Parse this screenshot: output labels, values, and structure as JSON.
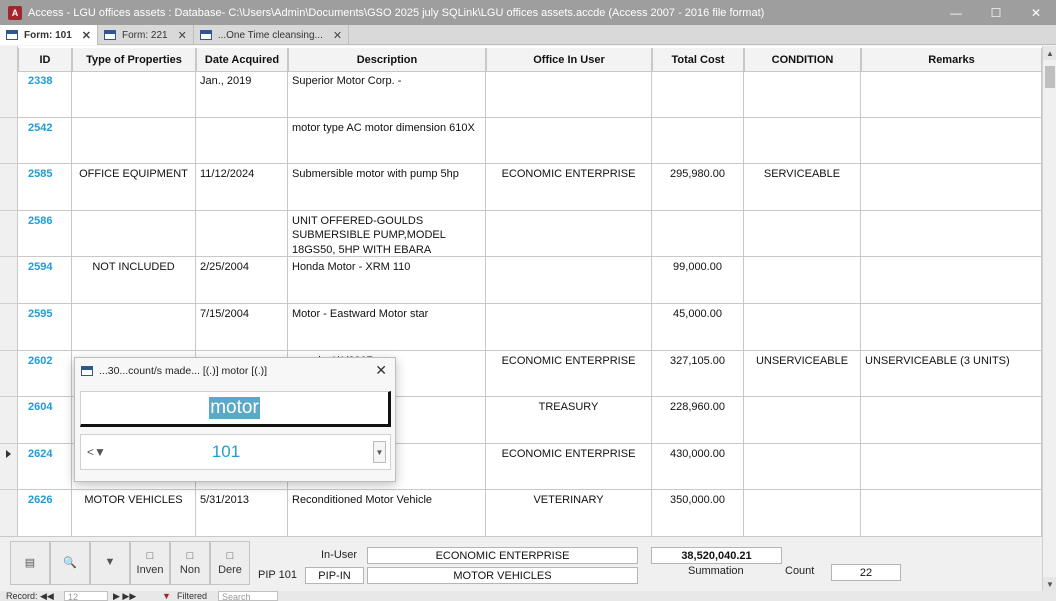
{
  "window": {
    "title": "Access - LGU offices assets : Database- C:\\Users\\Admin\\Documents\\GSO 2025 july SQLink\\LGU offices assets.accde (Access 2007 - 2016 file format)",
    "app_badge": "A"
  },
  "tabs": [
    {
      "label": "Form: 101",
      "active": true
    },
    {
      "label": "Form: 221",
      "active": false
    },
    {
      "label": "...One Time cleansing...",
      "active": false
    }
  ],
  "columns": [
    "ID",
    "Type of Properties",
    "Date Acquired",
    "Description",
    "Office In User",
    "Total Cost",
    "CONDITION",
    "Remarks"
  ],
  "rows": [
    {
      "id": "2338",
      "type": "",
      "date": "Jan., 2019",
      "desc": "Superior Motor Corp. -",
      "office": "",
      "cost": "",
      "condition": "",
      "remarks": ""
    },
    {
      "id": "2542",
      "type": "",
      "date": "",
      "desc": "motor type AC motor dimension 610X",
      "office": "",
      "cost": "",
      "condition": "",
      "remarks": ""
    },
    {
      "id": "2585",
      "type": "OFFICE EQUIPMENT",
      "date": "11/12/2024",
      "desc": "Submersible motor with pump 5hp",
      "office": "ECONOMIC ENTERPRISE",
      "cost": "295,980.00",
      "condition": "SERVICEABLE",
      "remarks": ""
    },
    {
      "id": "2586",
      "type": "",
      "date": "",
      "desc": "UNIT OFFERED-GOULDS SUBMERSIBLE PUMP,MODEL 18GS50, 5HP WITH EBARA SUBMERSIBLE",
      "office": "",
      "cost": "",
      "condition": "",
      "remarks": ""
    },
    {
      "id": "2594",
      "type": "NOT INCLUDED",
      "date": "2/25/2004",
      "desc": "Honda Motor - XRM 110",
      "office": "",
      "cost": "99,000.00",
      "condition": "",
      "remarks": ""
    },
    {
      "id": "2595",
      "type": "",
      "date": "7/15/2004",
      "desc": "Motor - Eastward Motor star",
      "office": "",
      "cost": "45,000.00",
      "condition": "",
      "remarks": ""
    },
    {
      "id": "2602",
      "type": "",
      "date": "",
      "desc": "orcycle 4/1/2007",
      "office": "ECONOMIC ENTERPRISE",
      "cost": "327,105.00",
      "condition": "UNSERVICEABLE",
      "remarks": "UNSERVICEABLE (3 UNITS)"
    },
    {
      "id": "2604",
      "type": "",
      "date": "",
      "desc": "200",
      "office": "TREASURY",
      "cost": "228,960.00",
      "condition": "",
      "remarks": ""
    },
    {
      "id": "2624",
      "type": "",
      "date": "",
      "desc": "otor Vehicle",
      "office": "ECONOMIC ENTERPRISE",
      "cost": "430,000.00",
      "condition": "",
      "remarks": ""
    },
    {
      "id": "2626",
      "type": "MOTOR VEHICLES",
      "date": "5/31/2013",
      "desc": "Reconditioned Motor Vehicle",
      "office": "VETERINARY",
      "cost": "350,000.00",
      "condition": "",
      "remarks": ""
    }
  ],
  "current_row_index": 8,
  "popup": {
    "title": "...30...count/s made... [(.)] motor [(.)]",
    "search_value": "motor",
    "selected_value": "101"
  },
  "footer": {
    "btn_inven": "Inven",
    "btn_non": "Non",
    "btn_dere": "Dere",
    "in_user_label": "In-User",
    "in_user_value": "ECONOMIC ENTERPRISE",
    "pip_label": "PIP 101",
    "pip_value": "PIP-IN",
    "category_value": "MOTOR VEHICLES",
    "sum_value": "38,520,040.21",
    "sum_label": "Summation",
    "count_label": "Count",
    "count_value": "22"
  },
  "status": {
    "record_label": "Record:",
    "record_value": "12",
    "filtered_label": "Filtered",
    "search_placeholder": "Search"
  }
}
